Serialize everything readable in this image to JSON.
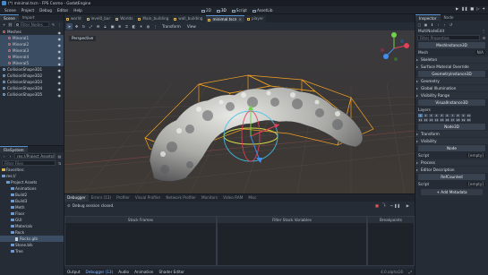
{
  "window": {
    "title": "(*) minimal.tscn - FPS Cosmo - GodotEngine"
  },
  "menu": [
    "Scene",
    "Project",
    "Debug",
    "Editor",
    "Help"
  ],
  "workspaces": [
    {
      "label": "2D",
      "active": false
    },
    {
      "label": "3D",
      "active": true
    },
    {
      "label": "Script",
      "active": false
    },
    {
      "label": "AssetLib",
      "active": false
    }
  ],
  "scene_dock": {
    "tabs": [
      "Scene",
      "Import"
    ],
    "filter_placeholder": "Filter Nodes",
    "nodes": [
      {
        "label": "Meshes",
        "selected": false,
        "indent": false
      },
      {
        "label": "Mineral1",
        "selected": true,
        "indent": true
      },
      {
        "label": "Mineral2",
        "selected": true,
        "indent": true
      },
      {
        "label": "Mineral3",
        "selected": true,
        "indent": true
      },
      {
        "label": "Mineral4",
        "selected": true,
        "indent": true
      },
      {
        "label": "Mineral5",
        "selected": true,
        "indent": true
      },
      {
        "label": "CollisionShape3D1",
        "selected": false,
        "indent": false
      },
      {
        "label": "CollisionShape3D2",
        "selected": false,
        "indent": false
      },
      {
        "label": "CollisionShape3D3",
        "selected": false,
        "indent": false
      },
      {
        "label": "CollisionShape3D4",
        "selected": false,
        "indent": false
      },
      {
        "label": "CollisionShape3D5",
        "selected": false,
        "indent": false
      }
    ]
  },
  "filesystem_dock": {
    "tab": "FileSystem",
    "path": "res://Project Assets/Ro",
    "filter_placeholder": "Filter Files",
    "items": [
      {
        "label": "Favorites:",
        "type": "folder",
        "depth": 0,
        "selected": false
      },
      {
        "label": "res://",
        "type": "folder",
        "depth": 0,
        "selected": false
      },
      {
        "label": "Project Assets",
        "type": "folder",
        "depth": 1,
        "selected": false
      },
      {
        "label": "Animations",
        "type": "folder",
        "depth": 2,
        "selected": false
      },
      {
        "label": "Build2",
        "type": "folder",
        "depth": 2,
        "selected": false
      },
      {
        "label": "Build3",
        "type": "folder",
        "depth": 2,
        "selected": false
      },
      {
        "label": "Meth",
        "type": "folder",
        "depth": 2,
        "selected": false
      },
      {
        "label": "Floor",
        "type": "folder",
        "depth": 2,
        "selected": false
      },
      {
        "label": "GUI",
        "type": "folder",
        "depth": 2,
        "selected": false
      },
      {
        "label": "Materials",
        "type": "folder",
        "depth": 2,
        "selected": false
      },
      {
        "label": "Rock",
        "type": "folder",
        "depth": 2,
        "selected": false
      },
      {
        "label": "Rocks.glb",
        "type": "file",
        "depth": 3,
        "selected": true
      },
      {
        "label": "Stone.blk",
        "type": "folder",
        "depth": 2,
        "selected": false
      },
      {
        "label": "Tree",
        "type": "folder",
        "depth": 2,
        "selected": false
      }
    ]
  },
  "editor_tabs": [
    {
      "label": "world",
      "active": false
    },
    {
      "label": "level0_bar",
      "active": false
    },
    {
      "label": "Worlds",
      "active": false
    },
    {
      "label": "Main_building",
      "active": false
    },
    {
      "label": "wall_building",
      "active": false
    },
    {
      "label": "minimal.tscn",
      "active": true
    },
    {
      "label": "player",
      "active": false
    }
  ],
  "viewport_toolbar": {
    "menus": [
      "Transform",
      "View"
    ]
  },
  "viewport": {
    "label": "Perspective"
  },
  "bottom_panel": {
    "tabs": [
      {
        "label": "Debugger",
        "active": true
      },
      {
        "label": "Errors (13)",
        "active": false
      },
      {
        "label": "Profiler",
        "active": false
      },
      {
        "label": "Visual Profiler",
        "active": false
      },
      {
        "label": "Network Profiler",
        "active": false
      },
      {
        "label": "Monitors",
        "active": false
      },
      {
        "label": "Video RAM",
        "active": false
      },
      {
        "label": "Misc",
        "active": false
      }
    ],
    "status": "Debug session closed.",
    "columns": [
      "Stack Frames",
      "Filter Stack Variables",
      "Breakpoints"
    ],
    "bottom_tabs": [
      {
        "label": "Output",
        "active": false
      },
      {
        "label": "Debugger (13)",
        "active": true
      },
      {
        "label": "Audio",
        "active": false
      },
      {
        "label": "Animation",
        "active": false
      },
      {
        "label": "Shader Editor",
        "active": false
      }
    ],
    "version": "4.0.alpha16"
  },
  "inspector": {
    "tabs": [
      "Inspector",
      "Node"
    ],
    "object": "MultiNodeEdit",
    "filter_placeholder": "Filter Properties",
    "class_title": "MeshInstance3D",
    "mesh_label": "Mesh",
    "mesh_value": "N/A",
    "sections": [
      "Skeleton",
      "Surface Material Override",
      "Geometry",
      "Global Illumination",
      "Visibility Range"
    ],
    "geometry_title": "GeometryInstance3D",
    "visual_title": "VisualInstance3D",
    "layers_label": "Layers",
    "layers": [
      1,
      2,
      3,
      4,
      5,
      6,
      7,
      8,
      9,
      10,
      11,
      12,
      13,
      14,
      15,
      16,
      17,
      18,
      19,
      20
    ],
    "node3d_title": "Node3D",
    "node3d_sections": [
      "Transform",
      "Visibility"
    ],
    "node_title": "Node",
    "script_label": "Script",
    "script_value": "[empty]",
    "process_section": "Process",
    "editor_desc_section": "Editor Description",
    "refcounted_title": "RefCounted",
    "script2_label": "Script",
    "script2_value": "[empty]",
    "add_metadata": "Add Metadata"
  }
}
